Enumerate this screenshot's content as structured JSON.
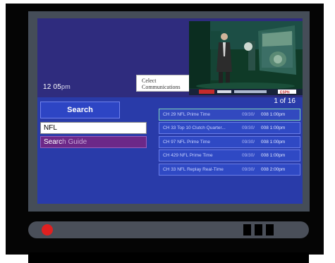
{
  "clock": {
    "time": "12 05",
    "ampm": "pm"
  },
  "sponsor": {
    "line1": "Celect",
    "line2": "Communications"
  },
  "video": {
    "description": "preview",
    "ticker_badge": "ESPN"
  },
  "search": {
    "button_label": "Search",
    "query": "NFL",
    "guide_prefix": "Searc",
    "guide_suffix": "h Guide"
  },
  "pagination": {
    "label": "1 of 16"
  },
  "results": [
    {
      "title": "CH 29 NFL Prime Time",
      "date": "09/30/",
      "slot": "008 1:00pm",
      "selected": true
    },
    {
      "title": "CH 33 Top 10 Clutch Quarter...",
      "date": "09/30/",
      "slot": "008 1:00pm",
      "selected": false
    },
    {
      "title": "CH 97 NFL Prime Time",
      "date": "09/30/",
      "slot": "008 1:00pm",
      "selected": false
    },
    {
      "title": "CH 429 NFL Prime Time",
      "date": "09/30/",
      "slot": "008 1:00pm",
      "selected": false
    },
    {
      "title": "CH 33 NFL Replay Real-Time",
      "date": "09/30/",
      "slot": "008 2:00pm",
      "selected": false
    }
  ],
  "colors": {
    "tv_frame": "#050505",
    "bezel": "#454d58",
    "screen": "#293ba9",
    "header_panel": "#2f2c7e",
    "search_guide": "#6c2888",
    "power_light": "#e02020"
  }
}
